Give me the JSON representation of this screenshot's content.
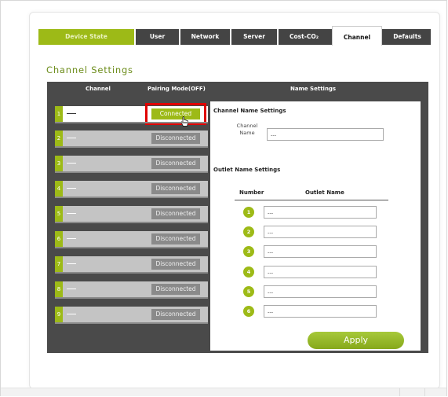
{
  "nav": {
    "tabs": [
      {
        "label": "Device State"
      },
      {
        "label": "User"
      },
      {
        "label": "Network"
      },
      {
        "label": "Server"
      },
      {
        "label": "Cost-CO₂"
      },
      {
        "label": "Channel"
      },
      {
        "label": "Defaults"
      }
    ],
    "active": "Channel"
  },
  "page_title": "Channel Settings",
  "table": {
    "headers": {
      "channel": "Channel",
      "pairing": "Pairing Mode(OFF)",
      "name_settings": "Name Settings"
    },
    "rows": [
      {
        "num": "1",
        "status": "Connected"
      },
      {
        "num": "2",
        "status": "Disconnected"
      },
      {
        "num": "3",
        "status": "Disconnected"
      },
      {
        "num": "4",
        "status": "Disconnected"
      },
      {
        "num": "5",
        "status": "Disconnected"
      },
      {
        "num": "6",
        "status": "Disconnected"
      },
      {
        "num": "7",
        "status": "Disconnected"
      },
      {
        "num": "8",
        "status": "Disconnected"
      },
      {
        "num": "9",
        "status": "Disconnected"
      }
    ]
  },
  "name_settings": {
    "channel_section_title": "Channel Name Settings",
    "channel_name_label_line1": "Channel",
    "channel_name_label_line2": "Name",
    "channel_name_value": "---",
    "outlet_section_title": "Outlet Name Settings",
    "col_number": "Number",
    "col_outlet_name": "Outlet Name",
    "outlets": [
      {
        "num": "1",
        "value": "---"
      },
      {
        "num": "2",
        "value": "---"
      },
      {
        "num": "3",
        "value": "---"
      },
      {
        "num": "4",
        "value": "---"
      },
      {
        "num": "5",
        "value": "---"
      },
      {
        "num": "6",
        "value": "---"
      }
    ],
    "apply_label": "Apply"
  },
  "colors": {
    "accent_green": "#9dba17",
    "highlight_red": "#e00000",
    "panel_dark": "#4a4a4a"
  }
}
